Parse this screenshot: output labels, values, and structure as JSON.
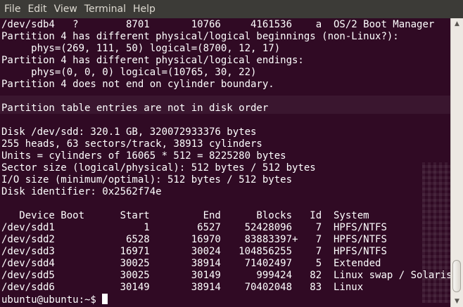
{
  "menubar": {
    "items": [
      "File",
      "Edit",
      "View",
      "Terminal",
      "Help"
    ]
  },
  "terminal": {
    "lines": [
      "/dev/sdb4   ?        8701       10766     4161536    a  OS/2 Boot Manager",
      "Partition 4 has different physical/logical beginnings (non-Linux?):",
      "     phys=(269, 111, 50) logical=(8700, 12, 17)",
      "Partition 4 has different physical/logical endings:",
      "     phys=(0, 0, 0) logical=(10765, 30, 22)",
      "Partition 4 does not end on cylinder boundary.",
      "",
      "Partition table entries are not in disk order",
      "",
      "Disk /dev/sdd: 320.1 GB, 320072933376 bytes",
      "255 heads, 63 sectors/track, 38913 cylinders",
      "Units = cylinders of 16065 * 512 = 8225280 bytes",
      "Sector size (logical/physical): 512 bytes / 512 bytes",
      "I/O size (minimum/optimal): 512 bytes / 512 bytes",
      "Disk identifier: 0x2562f74e",
      "",
      "   Device Boot      Start         End      Blocks   Id  System",
      "/dev/sdd1               1        6527    52428096    7  HPFS/NTFS",
      "/dev/sdd2            6528       16970    83883397+   7  HPFS/NTFS",
      "/dev/sdd3           16971       30024   104856255    7  HPFS/NTFS",
      "/dev/sdd4           30025       38914    71402497    5  Extended",
      "/dev/sdd5           30025       30149      999424   82  Linux swap / Solaris",
      "/dev/sdd6           30149       38914    70402048   83  Linux"
    ],
    "prompt": "ubuntu@ubuntu:~$ "
  },
  "colors": {
    "terminal_bg": "#300a24",
    "terminal_fg": "#ffffff",
    "menubar_bg": "#3c3b37",
    "menubar_fg": "#dfdbd2"
  }
}
